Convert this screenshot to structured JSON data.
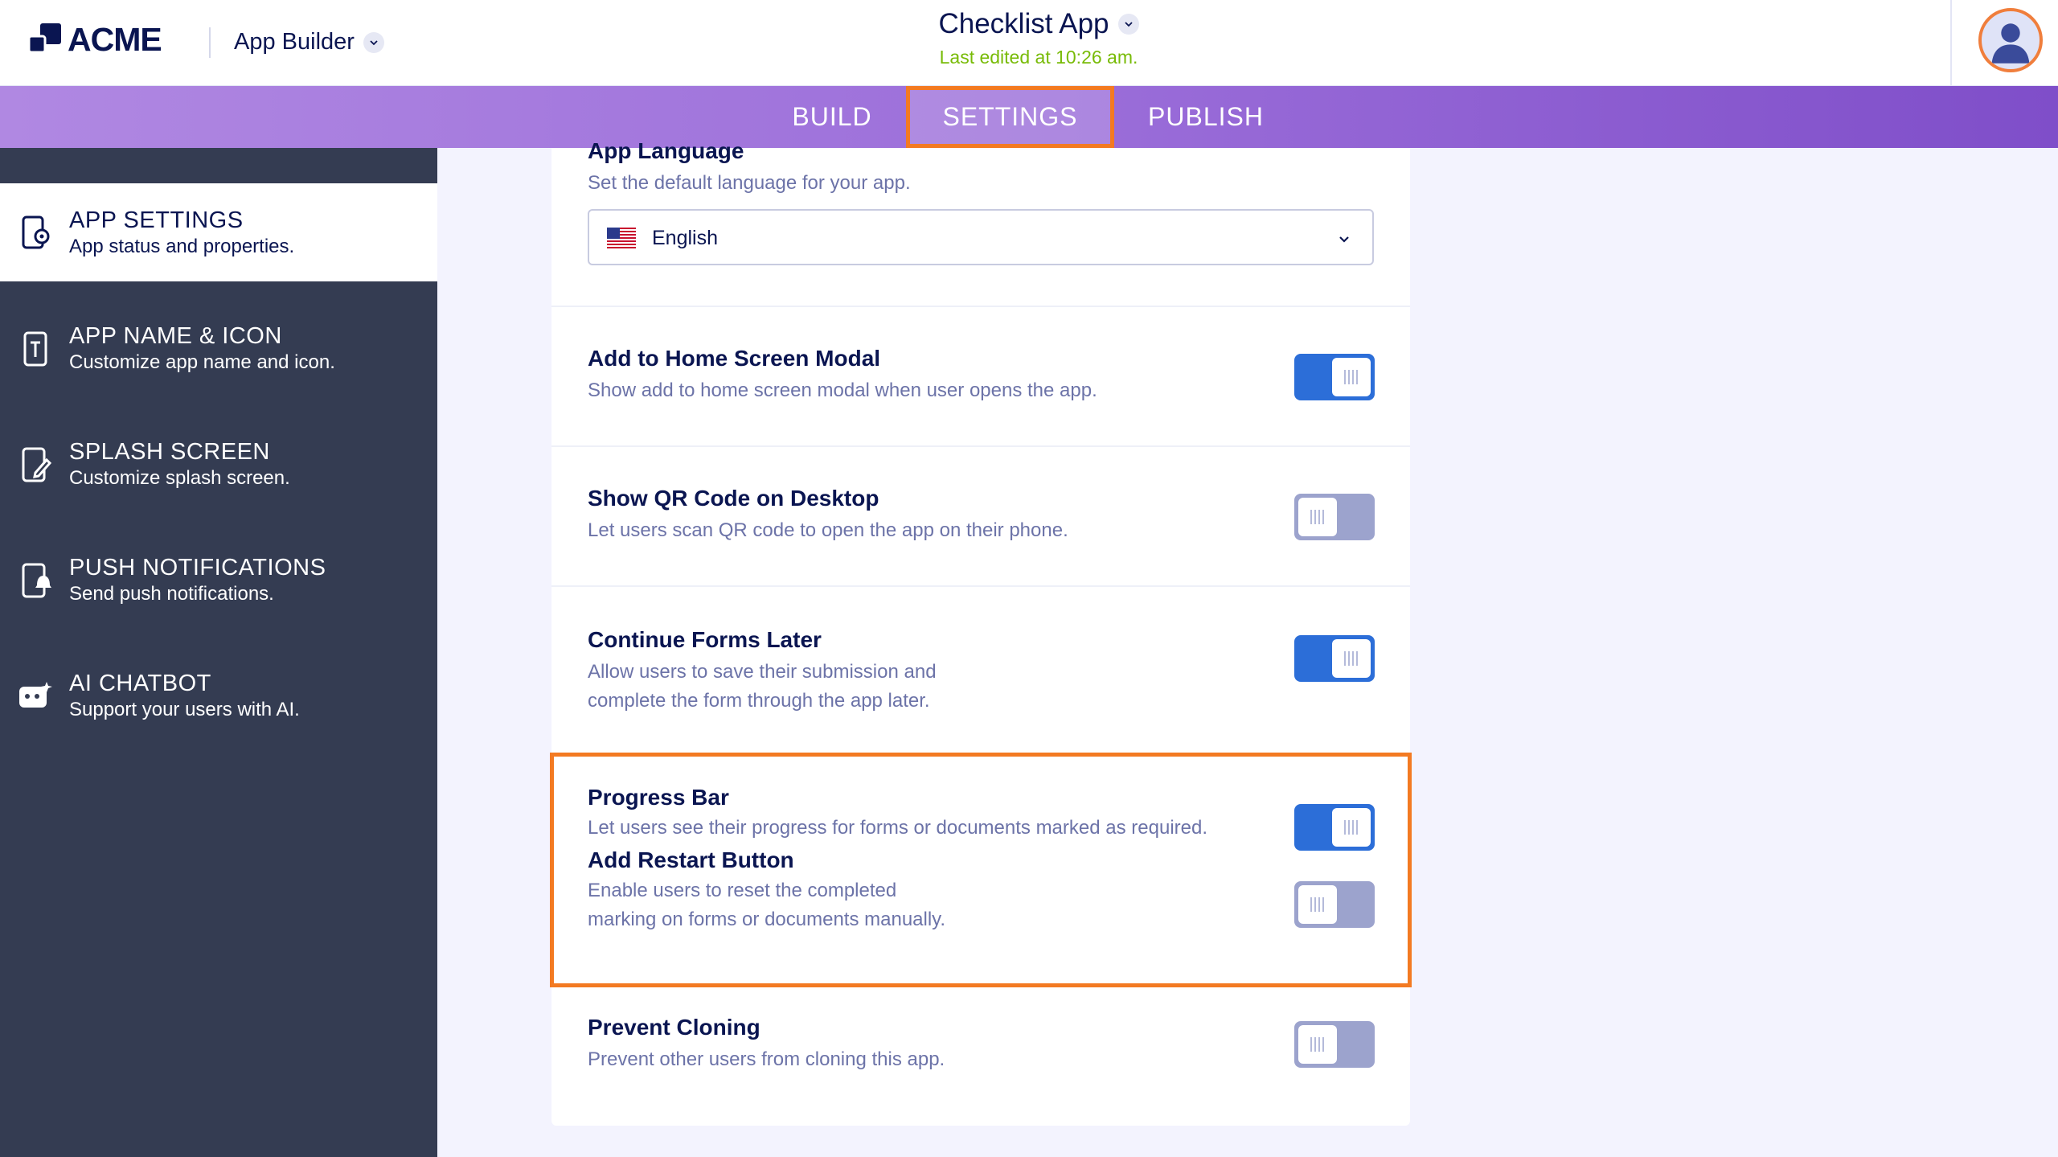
{
  "header": {
    "logo_text": "ACME",
    "app_builder_label": "App Builder",
    "app_title": "Checklist App",
    "last_edited": "Last edited at 10:26 am."
  },
  "nav": {
    "tabs": [
      {
        "label": "BUILD",
        "active": false
      },
      {
        "label": "SETTINGS",
        "active": true
      },
      {
        "label": "PUBLISH",
        "active": false
      }
    ]
  },
  "sidebar": {
    "items": [
      {
        "title": "APP SETTINGS",
        "desc": "App status and properties.",
        "icon": "settings-phone-icon",
        "active": true
      },
      {
        "title": "APP NAME & ICON",
        "desc": "Customize app name and icon.",
        "icon": "text-phone-icon",
        "active": false
      },
      {
        "title": "SPLASH SCREEN",
        "desc": "Customize splash screen.",
        "icon": "edit-phone-icon",
        "active": false
      },
      {
        "title": "PUSH NOTIFICATIONS",
        "desc": "Send push notifications.",
        "icon": "bell-phone-icon",
        "active": false
      },
      {
        "title": "AI CHATBOT",
        "desc": "Support your users with AI.",
        "icon": "chatbot-icon",
        "active": false
      }
    ]
  },
  "settings": {
    "language": {
      "title": "App Language",
      "desc": "Set the default language for your app.",
      "value": "English"
    },
    "home_screen": {
      "title": "Add to Home Screen Modal",
      "desc": "Show add to home screen modal when user opens the app.",
      "enabled": true
    },
    "qr_code": {
      "title": "Show QR Code on Desktop",
      "desc": "Let users scan QR code to open the app on their phone.",
      "enabled": false
    },
    "continue_forms": {
      "title": "Continue Forms Later",
      "desc_line1": "Allow users to save their submission and",
      "desc_line2": "complete the form through the app later.",
      "enabled": true
    },
    "progress_bar": {
      "title": "Progress Bar",
      "desc": "Let users see their progress for forms or documents marked as required.",
      "enabled": true
    },
    "restart_button": {
      "title": "Add Restart Button",
      "desc_line1": "Enable users to reset the completed",
      "desc_line2": "marking on forms or documents manually.",
      "enabled": false
    },
    "prevent_cloning": {
      "title": "Prevent Cloning",
      "desc": "Prevent other users from cloning this app.",
      "enabled": false
    }
  },
  "colors": {
    "highlight": "#f37a22",
    "toggle_on": "#2c6ed8",
    "toggle_off": "#9ca3cd",
    "sidebar_bg": "#343c52",
    "last_edited": "#78bb07"
  }
}
